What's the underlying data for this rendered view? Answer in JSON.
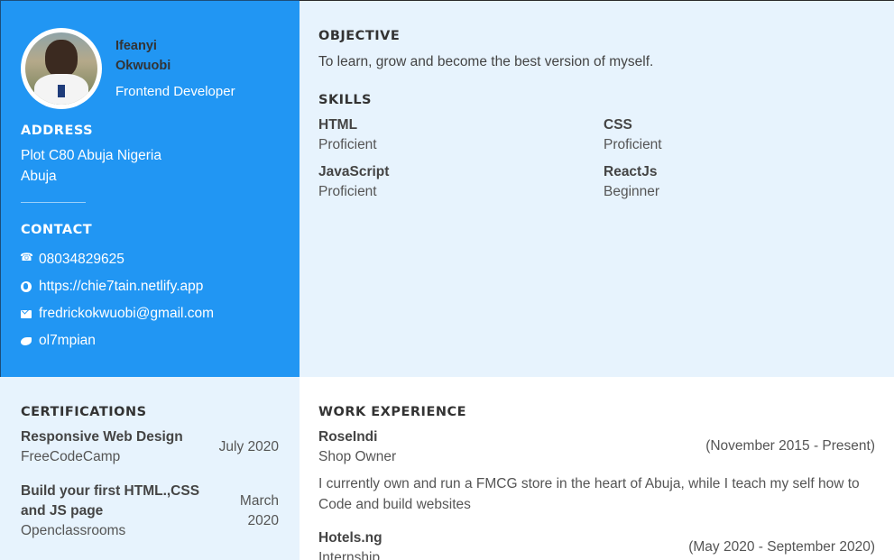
{
  "profile": {
    "first_name": "Ifeanyi",
    "last_name": "Okwuobi",
    "role": "Frontend Developer"
  },
  "address": {
    "title": "ADDRESS",
    "line1": "Plot C80 Abuja Nigeria",
    "line2": "Abuja"
  },
  "contact": {
    "title": "CONTACT",
    "items": [
      {
        "icon": "phone-icon",
        "text": "08034829625"
      },
      {
        "icon": "globe-icon",
        "text": "https://chie7tain.netlify.app"
      },
      {
        "icon": "mail-icon",
        "text": "fredrickokwuobi@gmail.com"
      },
      {
        "icon": "twitter-icon",
        "text": "ol7mpian"
      }
    ]
  },
  "objective": {
    "title": "OBJECTIVE",
    "text": "To learn, grow and become the best version of myself."
  },
  "skills": {
    "title": "SKILLS",
    "items": [
      {
        "name": "HTML",
        "level": "Proficient"
      },
      {
        "name": "CSS",
        "level": "Proficient"
      },
      {
        "name": "JavaScript",
        "level": "Proficient"
      },
      {
        "name": "ReactJs",
        "level": "Beginner"
      }
    ]
  },
  "certifications": {
    "title": "CERTIFICATIONS",
    "items": [
      {
        "name": "Responsive Web Design",
        "org": "FreeCodeCamp",
        "date": "July 2020"
      },
      {
        "name": "Build your first HTML.,CSS and JS page",
        "org": "Openclassrooms",
        "date": "March 2020"
      }
    ]
  },
  "work": {
    "title": "WORK EXPERIENCE",
    "items": [
      {
        "company": "RoseIndi",
        "role": "Shop Owner",
        "date": "(November 2015 - Present)",
        "description": "I currently own and run a FMCG store in the heart of Abuja, while I teach my self how to Code and build websites"
      },
      {
        "company": "Hotels.ng",
        "role": "Internship",
        "date": "(May 2020 - September 2020)"
      }
    ]
  },
  "colors": {
    "sidebar_blue": "#2196f3",
    "light_panel": "#e7f3fd"
  }
}
